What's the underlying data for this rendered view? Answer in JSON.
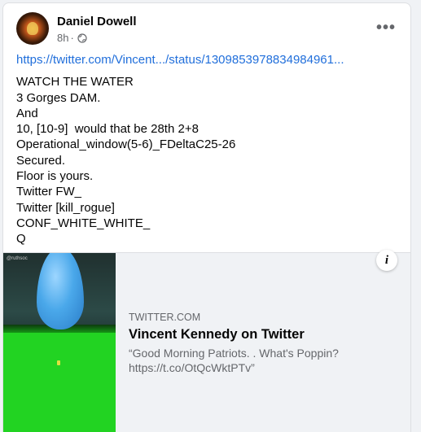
{
  "post": {
    "author": "Daniel Dowell",
    "timestamp": "8h",
    "dot": "·",
    "more_label": "•••",
    "link": "https://twitter.com/Vincent.../status/1309853978834984961...",
    "lines": [
      "WATCH THE WATER",
      "3 Gorges DAM.",
      "And",
      "10, [10-9]  would that be 28th 2+8",
      "Operational_window(5-6)_FDeltaC25-26",
      "Secured.",
      "Floor is yours.",
      "Twitter FW_",
      "Twitter [kill_rogue]",
      "CONF_WHITE_WHITE_",
      "Q"
    ]
  },
  "preview": {
    "domain": "TWITTER.COM",
    "title": "Vincent Kennedy on Twitter",
    "description": "“Good Morning Patriots. . What's Poppin? https://t.co/OtQcWktPTv”",
    "info_label": "i",
    "thumbnail_watermark": "@ruthsoc"
  },
  "icons": {
    "avatar": "avatar-image",
    "privacy": "globe-icon",
    "more": "more-options-icon",
    "info": "info-icon"
  },
  "colors": {
    "link": "#216fdb",
    "page_bg": "#f0f2f5",
    "card_bg": "#ffffff",
    "text": "#050505",
    "secondary": "#65676b"
  }
}
